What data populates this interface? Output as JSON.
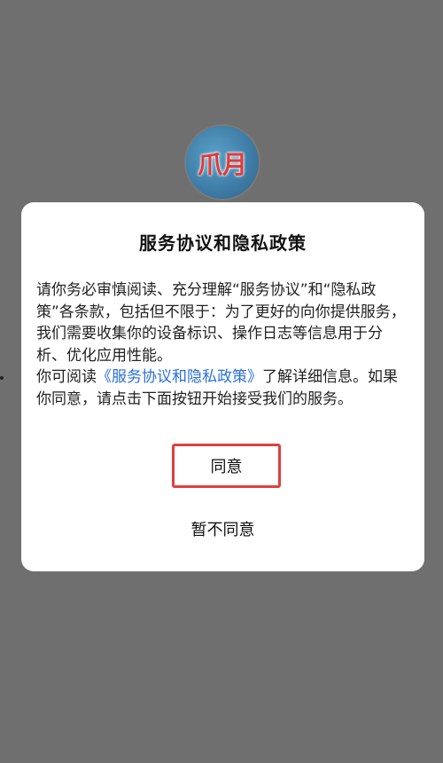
{
  "app": {
    "logo_text": "爪月",
    "logo_icon": "app-logo-icon"
  },
  "dialog": {
    "title": "服务协议和隐私政策",
    "paragraph1": "请你务必审慎阅读、充分理解“服务协议”和“隐私政策”各条款，包括但不限于：为了更好的向你提供服务，我们需要收集你的设备标识、操作日志等信息用于分析、优化应用性能。",
    "paragraph2_prefix": "你可阅读",
    "paragraph2_link": "《服务协议和隐私政策》",
    "paragraph2_suffix": "了解详细信息。如果你同意，请点击下面按钮开始接受我们的服务。",
    "agree_label": "同意",
    "disagree_label": "暂不同意"
  },
  "colors": {
    "background": "#6f6f6f",
    "link": "#2a6fdb",
    "highlight": "#e04040"
  }
}
